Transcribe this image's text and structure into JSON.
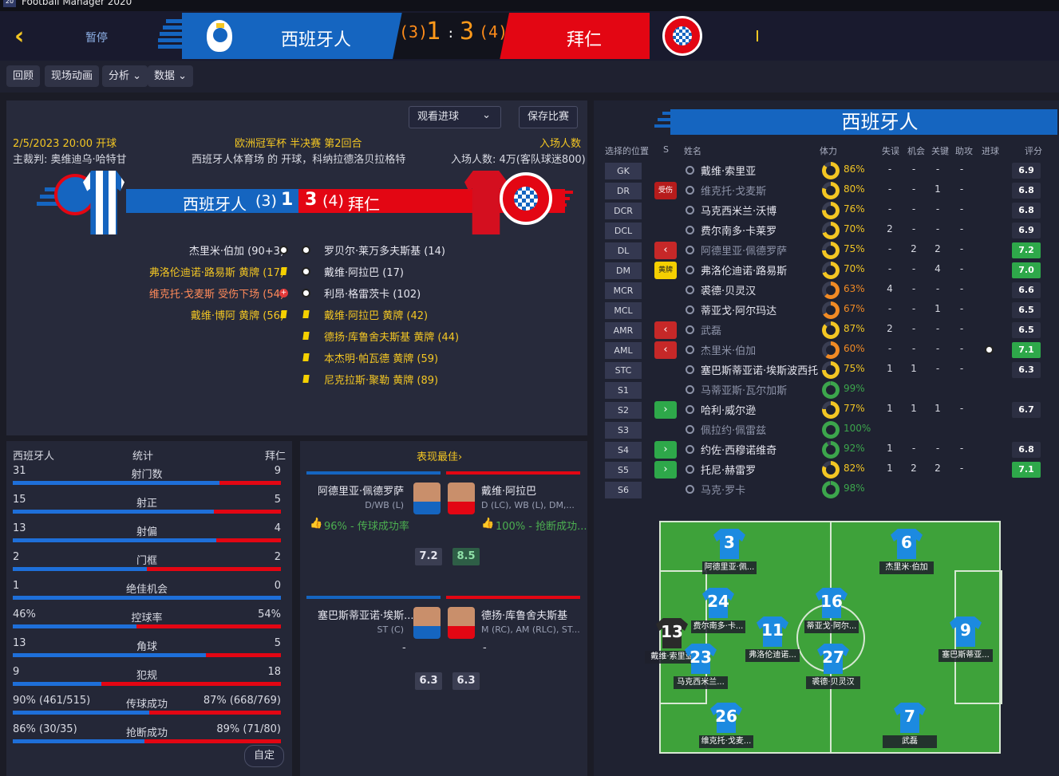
{
  "app": {
    "title": "Football Manager 2020",
    "logo": "20"
  },
  "header": {
    "pause": "暂停",
    "home": "西班牙人",
    "away": "拜仁",
    "home_agg": "(3)",
    "home_score": "1",
    "sep": ":",
    "away_score": "3",
    "away_agg": "(4)"
  },
  "toolbar": {
    "replay": "回顾",
    "match_anim": "现场动画",
    "analysis": "分析",
    "data": "数据"
  },
  "match": {
    "watch_goals": "观看进球",
    "save_match": "保存比赛",
    "kickoff": "2/5/2023 20:00 开球",
    "referee": "主裁判: 奥维迪乌·哈特甘",
    "competition": "欧洲冠军杯 半决赛 第2回合",
    "venue": "西班牙人体育场 的 开球，科纳拉德洛贝拉格特",
    "att_label": "入场人数",
    "attendance": "入场人数: 4万(客队球迷800)",
    "home": "西班牙人",
    "home_agg": "(3)",
    "home_score": "1",
    "away_score": "3",
    "away_agg": "(4)",
    "away": "拜仁",
    "home_events": [
      {
        "text": "杰里米·伯加 (90+3)",
        "type": "goal",
        "color": "#e6e6ef"
      },
      {
        "text": "弗洛伦迪诺·路易斯 黄牌 (17)",
        "type": "yellow",
        "color": "#f3c623"
      },
      {
        "text": "维克托·戈麦斯 受伤下场 (54)",
        "type": "injury",
        "color": "#ff8a5a"
      },
      {
        "text": "戴维·博阿 黄牌 (56)",
        "type": "yellow",
        "color": "#f3c623"
      }
    ],
    "away_events": [
      {
        "text": "罗贝尔·莱万多夫斯基 (14)",
        "type": "goal",
        "color": "#e6e6ef"
      },
      {
        "text": "戴维·阿拉巴 (17)",
        "type": "goal",
        "color": "#e6e6ef"
      },
      {
        "text": "利昂·格雷茨卡 (102)",
        "type": "goal",
        "color": "#e6e6ef"
      },
      {
        "text": "戴维·阿拉巴 黄牌 (42)",
        "type": "yellow",
        "color": "#f3c623"
      },
      {
        "text": "德扬·库鲁舍夫斯基 黄牌 (44)",
        "type": "yellow",
        "color": "#f3c623"
      },
      {
        "text": "本杰明·帕瓦德 黄牌 (59)",
        "type": "yellow",
        "color": "#f3c623"
      },
      {
        "text": "尼克拉斯·聚勒 黄牌 (89)",
        "type": "yellow",
        "color": "#f3c623"
      }
    ]
  },
  "stats": {
    "home": "西班牙人",
    "title": "统计",
    "away": "拜仁",
    "custom": "自定",
    "rows": [
      {
        "l": "31",
        "c": "射门数",
        "r": "9",
        "frac": 0.77
      },
      {
        "l": "15",
        "c": "射正",
        "r": "5",
        "frac": 0.75
      },
      {
        "l": "13",
        "c": "射偏",
        "r": "4",
        "frac": 0.76
      },
      {
        "l": "2",
        "c": "门框",
        "r": "2",
        "frac": 0.5
      },
      {
        "l": "1",
        "c": "绝佳机会",
        "r": "0",
        "frac": 1.0
      },
      {
        "l": "46%",
        "c": "控球率",
        "r": "54%",
        "frac": 0.46
      },
      {
        "l": "13",
        "c": "角球",
        "r": "5",
        "frac": 0.72
      },
      {
        "l": "9",
        "c": "犯规",
        "r": "18",
        "frac": 0.33
      },
      {
        "l": "90% (461/515)",
        "c": "传球成功",
        "r": "87% (668/769)",
        "frac": 0.51
      },
      {
        "l": "86% (30/35)",
        "c": "抢断成功",
        "r": "89% (71/80)",
        "frac": 0.49
      }
    ]
  },
  "best": {
    "title": "表现最佳",
    "cards": [
      {
        "name": "阿德里亚·佩德罗萨",
        "pos": "D/WB (L)",
        "stat": "96% - 传球成功率",
        "rating": "7.2",
        "team": "home"
      },
      {
        "name": "戴维·阿拉巴",
        "pos": "D (LC), WB (L), DM,...",
        "stat": "100% - 抢断成功...",
        "rating": "8.5",
        "team": "away"
      },
      {
        "name": "塞巴斯蒂亚诺·埃斯...",
        "pos": "ST (C)",
        "stat": "-",
        "rating": "6.3",
        "team": "home"
      },
      {
        "name": "德扬·库鲁舍夫斯基",
        "pos": "M (RC), AM (RLC), ST...",
        "stat": "-",
        "rating": "6.3",
        "team": "away"
      }
    ]
  },
  "squad": {
    "team": "西班牙人",
    "headers": {
      "pos": "选择的位置",
      "s": "S",
      "name": "姓名",
      "cond": "体力",
      "lost": "失误",
      "chance": "机会",
      "key": "关键",
      "assist": "助攻",
      "goal": "进球",
      "rating": "评分"
    },
    "players": [
      {
        "pos": "GK",
        "mark": "",
        "name": "戴维·索里亚",
        "cond": "86%",
        "c": 0.86,
        "a": "-",
        "b": "-",
        "k": "-",
        "d": "-",
        "g": "",
        "rating": "6.9",
        "dim": false
      },
      {
        "pos": "DR",
        "mark": "受伤",
        "name": "维克托·戈麦斯",
        "cond": "80%",
        "c": 0.8,
        "a": "-",
        "b": "-",
        "k": "1",
        "d": "-",
        "g": "",
        "rating": "6.8",
        "dim": true
      },
      {
        "pos": "DCR",
        "mark": "",
        "name": "马克西米兰·沃博",
        "cond": "76%",
        "c": 0.76,
        "a": "-",
        "b": "-",
        "k": "-",
        "d": "-",
        "g": "",
        "rating": "6.8",
        "dim": false
      },
      {
        "pos": "DCL",
        "mark": "",
        "name": "费尔南多·卡莱罗",
        "cond": "70%",
        "c": 0.7,
        "a": "2",
        "b": "-",
        "k": "-",
        "d": "-",
        "g": "",
        "rating": "6.9",
        "dim": false
      },
      {
        "pos": "DL",
        "mark": "<",
        "name": "阿德里亚·佩德罗萨",
        "cond": "75%",
        "c": 0.75,
        "a": "-",
        "b": "2",
        "k": "2",
        "d": "-",
        "g": "",
        "rating": "7.2",
        "dim": true
      },
      {
        "pos": "DM",
        "mark": "黄牌",
        "name": "弗洛伦迪诺·路易斯",
        "cond": "70%",
        "c": 0.7,
        "a": "-",
        "b": "-",
        "k": "4",
        "d": "-",
        "g": "",
        "rating": "7.0",
        "dim": false
      },
      {
        "pos": "MCR",
        "mark": "",
        "name": "裘德·贝灵汉",
        "cond": "63%",
        "c": 0.63,
        "a": "4",
        "b": "-",
        "k": "-",
        "d": "-",
        "g": "",
        "rating": "6.6",
        "dim": false
      },
      {
        "pos": "MCL",
        "mark": "",
        "name": "蒂亚戈·阿尔玛达",
        "cond": "67%",
        "c": 0.67,
        "a": "-",
        "b": "-",
        "k": "1",
        "d": "-",
        "g": "",
        "rating": "6.5",
        "dim": false
      },
      {
        "pos": "AMR",
        "mark": "<",
        "name": "武磊",
        "cond": "87%",
        "c": 0.87,
        "a": "2",
        "b": "-",
        "k": "-",
        "d": "-",
        "g": "",
        "rating": "6.5",
        "dim": true
      },
      {
        "pos": "AML",
        "mark": "<",
        "name": "杰里米·伯加",
        "cond": "60%",
        "c": 0.6,
        "a": "-",
        "b": "-",
        "k": "-",
        "d": "-",
        "g": "goal",
        "rating": "7.1",
        "dim": true
      },
      {
        "pos": "STC",
        "mark": "",
        "name": "塞巴斯蒂亚诺·埃斯波西托",
        "cond": "75%",
        "c": 0.75,
        "a": "1",
        "b": "1",
        "k": "-",
        "d": "-",
        "g": "",
        "rating": "6.3",
        "dim": false
      },
      {
        "pos": "S1",
        "mark": "",
        "name": "马蒂亚斯·瓦尔加斯",
        "cond": "99%",
        "c": 0.99,
        "a": "",
        "b": "",
        "k": "",
        "d": "",
        "g": "",
        "rating": "",
        "dim": true
      },
      {
        "pos": "S2",
        "mark": ">",
        "name": "哈利·威尔逊",
        "cond": "77%",
        "c": 0.77,
        "a": "1",
        "b": "1",
        "k": "1",
        "d": "-",
        "g": "",
        "rating": "6.7",
        "dim": false
      },
      {
        "pos": "S3",
        "mark": "",
        "name": "佩拉约·佩雷兹",
        "cond": "100%",
        "c": 1.0,
        "a": "",
        "b": "",
        "k": "",
        "d": "",
        "g": "",
        "rating": "",
        "dim": true
      },
      {
        "pos": "S4",
        "mark": ">",
        "name": "约佐·西穆诺维奇",
        "cond": "92%",
        "c": 0.92,
        "a": "1",
        "b": "-",
        "k": "-",
        "d": "-",
        "g": "",
        "rating": "6.8",
        "dim": false
      },
      {
        "pos": "S5",
        "mark": ">",
        "name": "托尼·赫雷罗",
        "cond": "82%",
        "c": 0.82,
        "a": "1",
        "b": "2",
        "k": "2",
        "d": "-",
        "g": "",
        "rating": "7.1",
        "dim": false
      },
      {
        "pos": "S6",
        "mark": "",
        "name": "马克·罗卡",
        "cond": "98%",
        "c": 0.98,
        "a": "",
        "b": "",
        "k": "",
        "d": "",
        "g": "",
        "rating": "",
        "dim": true
      }
    ]
  },
  "pitch": [
    {
      "num": "3",
      "label": "阿德里亚·佩...",
      "kind": "out"
    },
    {
      "num": "6",
      "label": "杰里米·伯加",
      "kind": "out"
    },
    {
      "num": "24",
      "label": "费尔南多·卡...",
      "kind": "out"
    },
    {
      "num": "16",
      "label": "蒂亚戈·阿尔...",
      "kind": "out"
    },
    {
      "num": "13",
      "label": "戴维·索里亚",
      "kind": "gk"
    },
    {
      "num": "11",
      "label": "弗洛伦迪诺...",
      "kind": "out"
    },
    {
      "num": "9",
      "label": "塞巴斯蒂亚...",
      "kind": "out"
    },
    {
      "num": "23",
      "label": "马克西米兰...",
      "kind": "out"
    },
    {
      "num": "27",
      "label": "裘德·贝灵汉",
      "kind": "out"
    },
    {
      "num": "26",
      "label": "维克托·戈麦...",
      "kind": "out"
    },
    {
      "num": "7",
      "label": "武磊",
      "kind": "out"
    }
  ],
  "colors": {
    "home": "#1565c0",
    "away": "#e30613",
    "accent": "#f3c623",
    "rating_green": "#2ea84a"
  }
}
